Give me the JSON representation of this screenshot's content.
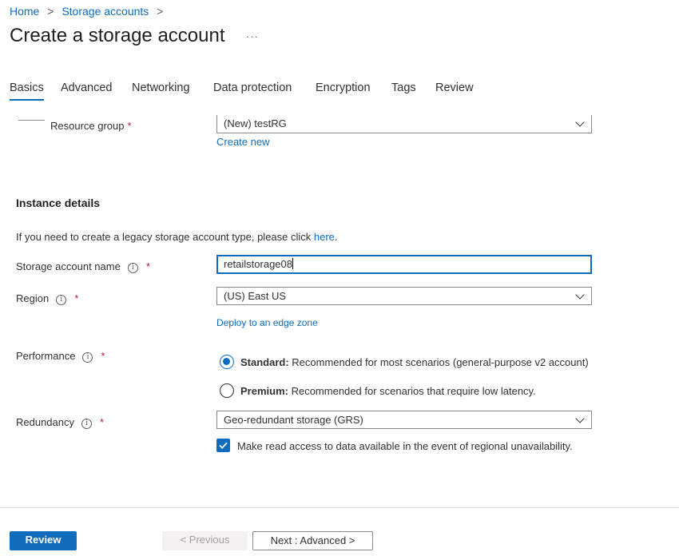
{
  "breadcrumb": {
    "home": "Home",
    "sep1": ">",
    "storage_accounts": "Storage accounts",
    "sep2": ">"
  },
  "page": {
    "title": "Create a storage account",
    "more": "···"
  },
  "tabs": [
    "Basics",
    "Advanced",
    "Networking",
    "Data protection",
    "Encryption",
    "Tags",
    "Review"
  ],
  "resource_group": {
    "label": "Resource group",
    "required": "*",
    "value": "(New) testRG",
    "create_new": "Create new"
  },
  "instance_details": {
    "heading": "Instance details",
    "legacy_text": "If you need to create a legacy storage account type, please click ",
    "legacy_link": "here",
    "legacy_end": "."
  },
  "storage_name": {
    "label": "Storage account name",
    "required": "*",
    "value": "retailstorage08"
  },
  "region": {
    "label": "Region",
    "required": "*",
    "value": "(US) East US",
    "edge_link": "Deploy to an edge zone"
  },
  "performance": {
    "label": "Performance",
    "required": "*",
    "options": [
      {
        "bold": "Standard:",
        "text": " Recommended for most scenarios (general-purpose v2 account)",
        "selected": true
      },
      {
        "bold": "Premium:",
        "text": " Recommended for scenarios that require low latency.",
        "selected": false
      }
    ]
  },
  "redundancy": {
    "label": "Redundancy",
    "required": "*",
    "value": "Geo-redundant storage (GRS)",
    "checkbox_label": "Make read access to data available in the event of regional unavailability.",
    "checked": true
  },
  "footer": {
    "review": "Review",
    "previous": "< Previous",
    "next": "Next : Advanced >"
  },
  "colors": {
    "accent": "#0f6cbd",
    "required": "#a4262c",
    "disabled_bg": "#f3f2f1"
  }
}
